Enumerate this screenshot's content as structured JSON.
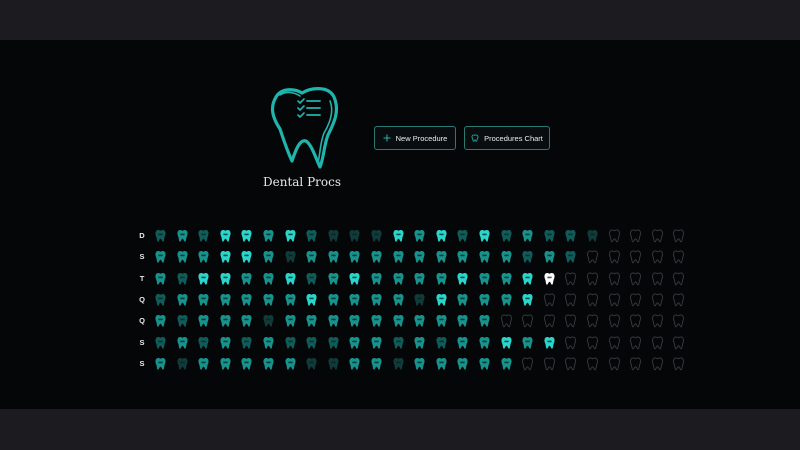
{
  "app": {
    "title": "Dental Procs",
    "buttons": {
      "new_procedure": {
        "label": "New Procedure",
        "icon": "plus-icon"
      },
      "procedures_chart": {
        "label": "Procedures Chart",
        "icon": "tooth-icon"
      }
    }
  },
  "colors": {
    "accent": "#1fb5ad",
    "bright": "#2ad6cb",
    "mid": "#17938c",
    "dim": "#0f5c58",
    "dark": "#103b39",
    "empty_outline": "#3a3d40",
    "highlight": "#ffffff"
  },
  "grid": {
    "rows": [
      {
        "label": "D",
        "teeth": [
          "d",
          "m",
          "d",
          "b",
          "b",
          "m",
          "b",
          "d",
          "k",
          "k",
          "k",
          "b",
          "m",
          "b",
          "d",
          "b",
          "d",
          "m",
          "d",
          "d",
          "k",
          "o",
          "o",
          "o",
          "o"
        ]
      },
      {
        "label": "S",
        "teeth": [
          "m",
          "m",
          "m",
          "b",
          "b",
          "m",
          "k",
          "m",
          "m",
          "m",
          "m",
          "m",
          "m",
          "m",
          "m",
          "m",
          "m",
          "d",
          "m",
          "d",
          "o",
          "o",
          "o",
          "o",
          "o"
        ]
      },
      {
        "label": "T",
        "teeth": [
          "m",
          "d",
          "b",
          "b",
          "m",
          "m",
          "b",
          "d",
          "m",
          "b",
          "m",
          "m",
          "m",
          "m",
          "b",
          "m",
          "m",
          "b",
          "w",
          "o",
          "o",
          "o",
          "o",
          "o",
          "o"
        ]
      },
      {
        "label": "Q",
        "teeth": [
          "d",
          "m",
          "m",
          "m",
          "m",
          "m",
          "m",
          "b",
          "m",
          "m",
          "m",
          "m",
          "k",
          "b",
          "m",
          "m",
          "m",
          "b",
          "o",
          "o",
          "o",
          "o",
          "o",
          "o",
          "o"
        ]
      },
      {
        "label": "Q",
        "teeth": [
          "m",
          "d",
          "m",
          "m",
          "m",
          "k",
          "m",
          "m",
          "m",
          "m",
          "m",
          "m",
          "m",
          "m",
          "m",
          "m",
          "o",
          "o",
          "o",
          "o",
          "o",
          "o",
          "o",
          "o",
          "o"
        ]
      },
      {
        "label": "S",
        "teeth": [
          "d",
          "m",
          "d",
          "m",
          "d",
          "m",
          "d",
          "d",
          "d",
          "m",
          "m",
          "d",
          "m",
          "d",
          "m",
          "m",
          "b",
          "m",
          "b",
          "o",
          "o",
          "o",
          "o",
          "o",
          "o"
        ]
      },
      {
        "label": "S",
        "teeth": [
          "m",
          "k",
          "m",
          "m",
          "m",
          "m",
          "m",
          "k",
          "k",
          "m",
          "m",
          "k",
          "m",
          "m",
          "m",
          "m",
          "m",
          "o",
          "o",
          "o",
          "o",
          "o",
          "o",
          "o",
          "o"
        ]
      }
    ]
  }
}
